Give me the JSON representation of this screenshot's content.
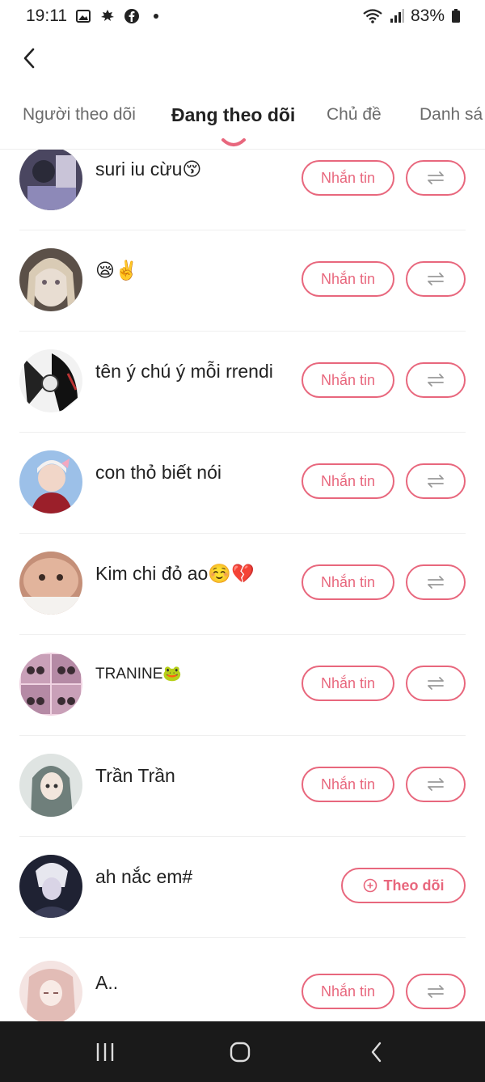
{
  "status_bar": {
    "time": "19:11",
    "battery": "83%",
    "icons_left": [
      "image-icon",
      "maple-leaf-icon",
      "facebook-icon",
      "dot-icon"
    ],
    "icons_right": [
      "wifi-icon",
      "signal-icon",
      "battery-icon"
    ]
  },
  "tabs": [
    {
      "label": "Người theo dõi",
      "active": false
    },
    {
      "label": "Đang theo dõi",
      "active": true
    },
    {
      "label": "Chủ đề",
      "active": false
    },
    {
      "label": "Danh sá",
      "active": false
    }
  ],
  "colors": {
    "accent": "#e8677d",
    "nav_bg": "#1a1a1a"
  },
  "users": [
    {
      "name": "suri iu cừu😚",
      "action": "Nhắn tin",
      "avatar_color": "#6d6a8a"
    },
    {
      "name": "😪✌️",
      "action": "Nhắn tin",
      "avatar_color": "#b8a79b"
    },
    {
      "name": "tên ý chú ý mỗi rrendi",
      "action": "Nhắn tin",
      "avatar_color": "#3a3a3a"
    },
    {
      "name": "con thỏ biết nói",
      "action": "Nhắn tin",
      "avatar_color": "#8fb0d8"
    },
    {
      "name": "Kim chi đỏ ao☺️💔",
      "action": "Nhắn tin",
      "avatar_color": "#d8a892"
    },
    {
      "name": "TRANINE🐸",
      "action": "Nhắn tin",
      "avatar_color": "#d6a7c2"
    },
    {
      "name": "Trần Trần",
      "action": "Nhắn tin",
      "avatar_color": "#8b9a97"
    },
    {
      "name": "ah nắc em#",
      "action": "Theo dõi",
      "avatar_color": "#2b2d3f"
    },
    {
      "name": "A..",
      "action": "Nhắn tin",
      "avatar_color": "#e8c4c0"
    }
  ]
}
